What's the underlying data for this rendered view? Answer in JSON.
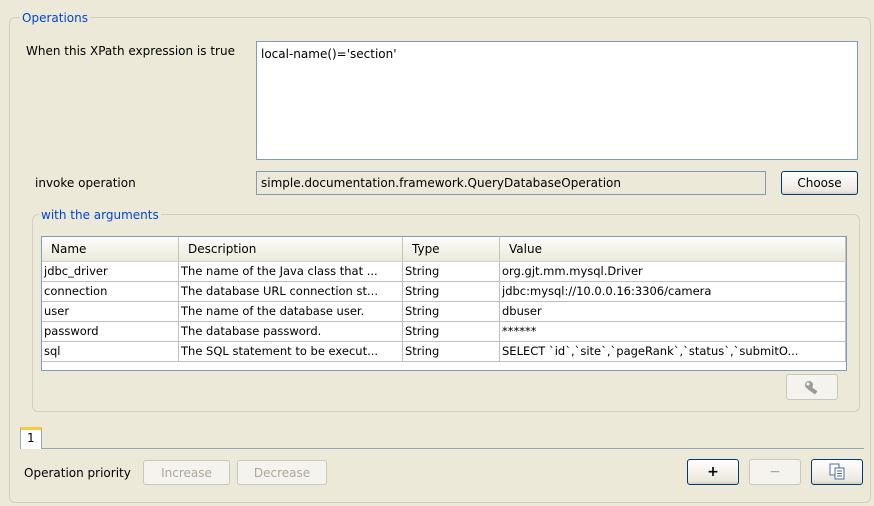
{
  "operations": {
    "legend": "Operations",
    "xpath_label": "When this XPath expression is true",
    "xpath_value": "local-name()='section'",
    "invoke_label": "invoke operation",
    "invoke_value": "simple.documentation.framework.QueryDatabaseOperation",
    "choose_label": "Choose"
  },
  "arguments": {
    "legend": "with the arguments",
    "columns": [
      "Name",
      "Description",
      "Type",
      "Value"
    ],
    "rows": [
      [
        "jdbc_driver",
        "The name of the Java class that ...",
        "String",
        "org.gjt.mm.mysql.Driver"
      ],
      [
        "connection",
        "The database URL connection st...",
        "String",
        "jdbc:mysql://10.0.0.16:3306/camera"
      ],
      [
        "user",
        "The name of the database user.",
        "String",
        "dbuser"
      ],
      [
        "password",
        "The database password.",
        "String",
        "******"
      ],
      [
        "sql",
        "The SQL statement to be execut...",
        "String",
        "SELECT `id`,`site`,`pageRank`,`status`,`submitO..."
      ]
    ],
    "edit_button_icon": "wrench-icon"
  },
  "tabs": [
    {
      "label": "1"
    }
  ],
  "footer": {
    "priority_label": "Operation priority",
    "increase_label": "Increase",
    "decrease_label": "Decrease",
    "add_label": "+",
    "remove_label": "−",
    "copy_icon": "copy-icon"
  }
}
